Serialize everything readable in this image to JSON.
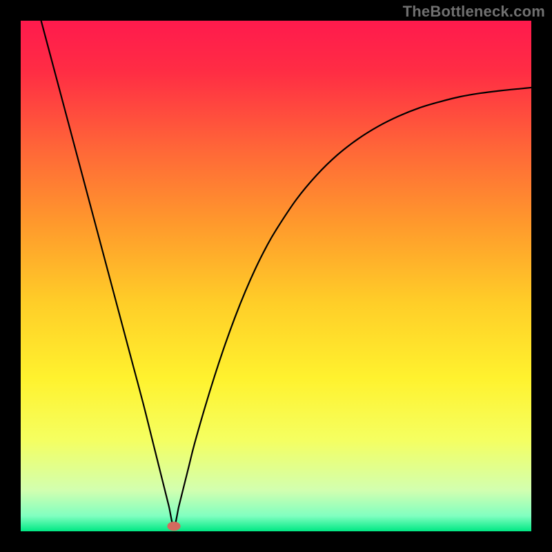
{
  "watermark": "TheBottleneck.com",
  "chart_data": {
    "type": "line",
    "title": "",
    "xlabel": "",
    "ylabel": "",
    "xlim": [
      0,
      100
    ],
    "ylim": [
      0,
      100
    ],
    "grid": false,
    "legend": false,
    "background_gradient": {
      "stops": [
        {
          "pos": 0.0,
          "color": "#ff1a4d"
        },
        {
          "pos": 0.1,
          "color": "#ff2d44"
        },
        {
          "pos": 0.25,
          "color": "#ff6638"
        },
        {
          "pos": 0.4,
          "color": "#ff9a2c"
        },
        {
          "pos": 0.55,
          "color": "#ffcd28"
        },
        {
          "pos": 0.7,
          "color": "#fff22e"
        },
        {
          "pos": 0.82,
          "color": "#f5ff60"
        },
        {
          "pos": 0.92,
          "color": "#d2ffb0"
        },
        {
          "pos": 0.97,
          "color": "#80ffc0"
        },
        {
          "pos": 1.0,
          "color": "#00e884"
        }
      ]
    },
    "marker": {
      "x": 30,
      "y": 1,
      "color": "#d46a5e",
      "rx": 1.3,
      "ry": 0.9
    },
    "series": [
      {
        "name": "curve",
        "color": "#000000",
        "x": [
          4,
          6,
          8,
          10,
          12,
          14,
          16,
          18,
          20,
          22,
          24,
          26,
          27,
          28,
          29,
          30,
          31,
          32,
          33,
          34,
          36,
          38,
          40,
          42,
          44,
          46,
          48,
          50,
          54,
          58,
          62,
          66,
          70,
          74,
          78,
          82,
          86,
          90,
          94,
          98,
          100
        ],
        "y": [
          100,
          92.5,
          85,
          77.5,
          70,
          62.5,
          55,
          47.5,
          40,
          32.5,
          25,
          17,
          13,
          9,
          5,
          1,
          5,
          9,
          13,
          17,
          24,
          30.5,
          36.5,
          42,
          47,
          51.5,
          55.5,
          59,
          65,
          69.8,
          73.7,
          76.8,
          79.3,
          81.3,
          82.9,
          84.1,
          85.1,
          85.8,
          86.3,
          86.7,
          86.9
        ]
      }
    ]
  }
}
